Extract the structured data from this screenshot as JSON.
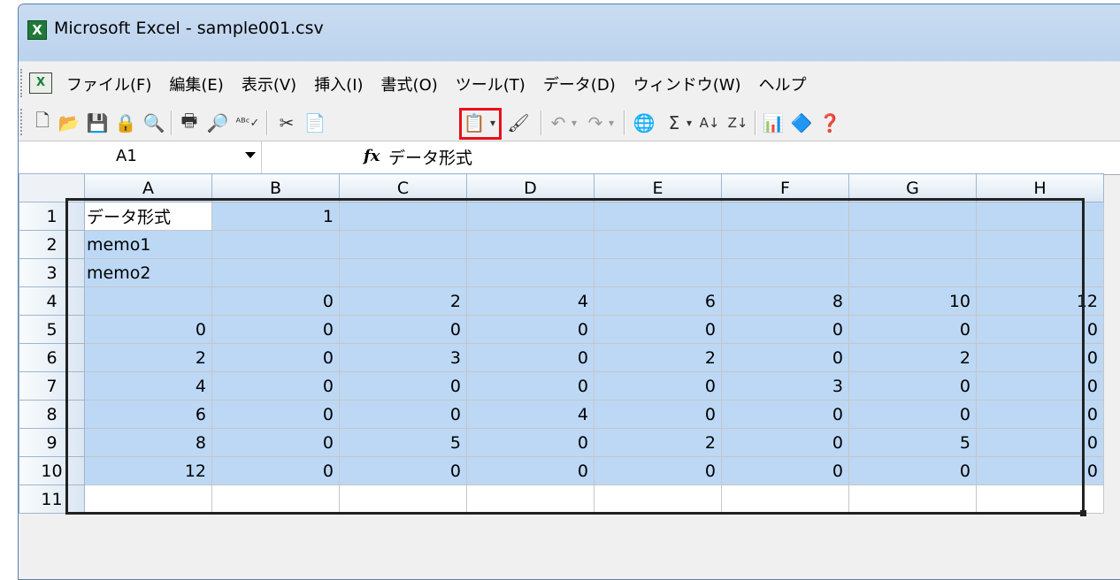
{
  "window": {
    "title": "Microsoft Excel - sample001.csv"
  },
  "menu": [
    "ファイル(F)",
    "編集(E)",
    "表示(V)",
    "挿入(I)",
    "書式(O)",
    "ツール(T)",
    "データ(D)",
    "ウィンドウ(W)",
    "ヘルプ"
  ],
  "toolbar": {
    "icons": [
      "new-icon",
      "open-icon",
      "save-icon",
      "permission-icon",
      "research-icon",
      "print-icon",
      "print-preview-icon",
      "spelling-icon",
      "cut-icon",
      "copy-icon",
      "paste-icon",
      "format-painter-icon",
      "undo-icon",
      "redo-icon",
      "hyperlink-icon",
      "autosum-icon",
      "sort-asc-icon",
      "sort-desc-icon",
      "chart-wizard-icon",
      "drawing-icon",
      "help-icon"
    ],
    "highlighted": "paste-icon",
    "highlight_color": "#e8101a"
  },
  "formula_bar": {
    "name_box": "A1",
    "fx": "fx",
    "value": "データ形式"
  },
  "grid": {
    "columns": [
      "A",
      "B",
      "C",
      "D",
      "E",
      "F",
      "G",
      "H"
    ],
    "rows": [
      {
        "num": "1",
        "cells": [
          "データ形式",
          "1",
          "",
          "",
          "",
          "",
          "",
          ""
        ]
      },
      {
        "num": "2",
        "cells": [
          "memo1",
          "",
          "",
          "",
          "",
          "",
          "",
          ""
        ]
      },
      {
        "num": "3",
        "cells": [
          "memo2",
          "",
          "",
          "",
          "",
          "",
          "",
          ""
        ]
      },
      {
        "num": "4",
        "cells": [
          "",
          "0",
          "2",
          "4",
          "6",
          "8",
          "10",
          "12"
        ]
      },
      {
        "num": "5",
        "cells": [
          "0",
          "0",
          "0",
          "0",
          "0",
          "0",
          "0",
          "0"
        ]
      },
      {
        "num": "6",
        "cells": [
          "2",
          "0",
          "3",
          "0",
          "2",
          "0",
          "2",
          "0"
        ]
      },
      {
        "num": "7",
        "cells": [
          "4",
          "0",
          "0",
          "0",
          "0",
          "3",
          "0",
          "0"
        ]
      },
      {
        "num": "8",
        "cells": [
          "6",
          "0",
          "0",
          "4",
          "0",
          "0",
          "0",
          "0"
        ]
      },
      {
        "num": "9",
        "cells": [
          "8",
          "0",
          "5",
          "0",
          "2",
          "0",
          "5",
          "0"
        ]
      },
      {
        "num": "10",
        "cells": [
          "12",
          "0",
          "0",
          "0",
          "0",
          "0",
          "0",
          "0"
        ]
      },
      {
        "num": "11",
        "cells": [
          "",
          "",
          "",
          "",
          "",
          "",
          "",
          ""
        ]
      }
    ],
    "selection_color": "#bcd8f5"
  }
}
